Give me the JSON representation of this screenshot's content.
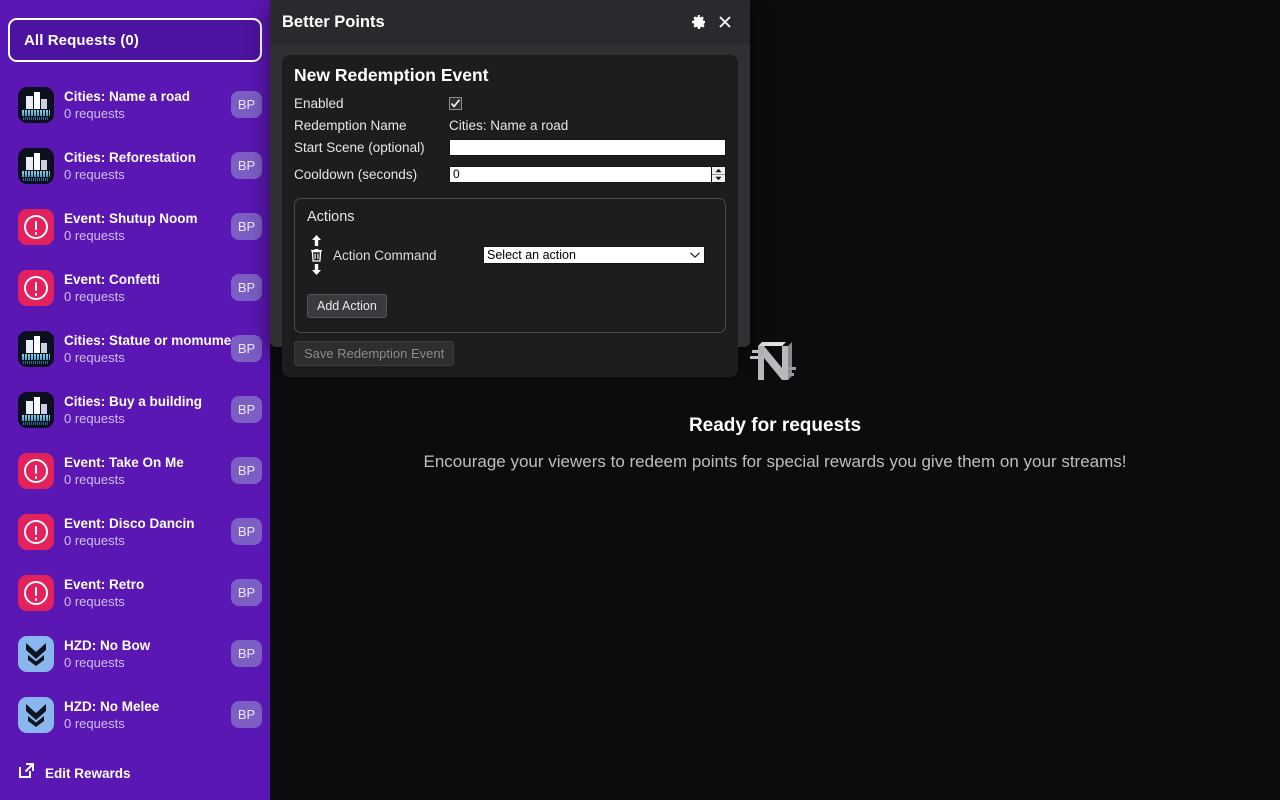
{
  "sidebar": {
    "all_requests_label": "All Requests (0)",
    "edit_rewards_label": "Edit Rewards",
    "edit_rewards_icon": "external-link-icon",
    "badge_label": "BP",
    "rewards": [
      {
        "title": "Cities: Name a road",
        "requests": "0 requests",
        "badge": "BP",
        "icon": "cities-skylines-icon"
      },
      {
        "title": "Cities: Reforestation",
        "requests": "0 requests",
        "badge": "BP",
        "icon": "cities-skylines-icon"
      },
      {
        "title": "Event: Shutup Noom",
        "requests": "0 requests",
        "badge": "BP",
        "icon": "alert-circle-icon"
      },
      {
        "title": "Event: Confetti",
        "requests": "0 requests",
        "badge": "BP",
        "icon": "alert-circle-icon"
      },
      {
        "title": "Cities: Statue or momument",
        "requests": "0 requests",
        "badge": "BP",
        "icon": "cities-skylines-icon"
      },
      {
        "title": "Cities: Buy a building",
        "requests": "0 requests",
        "badge": "BP",
        "icon": "cities-skylines-icon"
      },
      {
        "title": "Event: Take On Me",
        "requests": "0 requests",
        "badge": "BP",
        "icon": "alert-circle-icon"
      },
      {
        "title": "Event: Disco Dancin",
        "requests": "0 requests",
        "badge": "BP",
        "icon": "alert-circle-icon"
      },
      {
        "title": "Event: Retro",
        "requests": "0 requests",
        "badge": "BP",
        "icon": "alert-circle-icon"
      },
      {
        "title": "HZD: No Bow",
        "requests": "0 requests",
        "badge": "BP",
        "icon": "horizon-chevron-icon"
      },
      {
        "title": "HZD: No Melee",
        "requests": "0 requests",
        "badge": "BP",
        "icon": "horizon-chevron-icon"
      }
    ]
  },
  "main": {
    "logo_icon": "n-logo-icon",
    "title": "Ready for requests",
    "subtitle": "Encourage your viewers to redeem points for special rewards you give them on your streams!"
  },
  "dialog": {
    "title": "Better Points",
    "settings_icon": "gear-icon",
    "close_icon": "close-icon",
    "form_title": "New Redemption Event",
    "fields": {
      "enabled_label": "Enabled",
      "enabled_checked": true,
      "redemption_name_label": "Redemption Name",
      "redemption_name_value": "Cities: Name a road",
      "start_scene_label": "Start Scene (optional)",
      "start_scene_value": "",
      "start_scene_placeholder": "",
      "cooldown_label": "Cooldown (seconds)",
      "cooldown_value": "0"
    },
    "actions": {
      "section_title": "Actions",
      "move_up_icon": "arrow-up-icon",
      "delete_icon": "trash-icon",
      "move_down_icon": "arrow-down-icon",
      "row_label": "Action Command",
      "select_value": "Select an action",
      "select_icon": "chevron-down-icon",
      "add_action_label": "Add Action"
    },
    "save_label": "Save Redemption Event",
    "save_disabled": true
  },
  "colors": {
    "sidebar_purple": "#5a17b3",
    "badge_purple": "#7c5ec4",
    "alert_pink": "#e3215c",
    "hzd_blue": "#8ab6f0",
    "dialog_gray": "#303034",
    "card_black": "#1d1d1f"
  }
}
